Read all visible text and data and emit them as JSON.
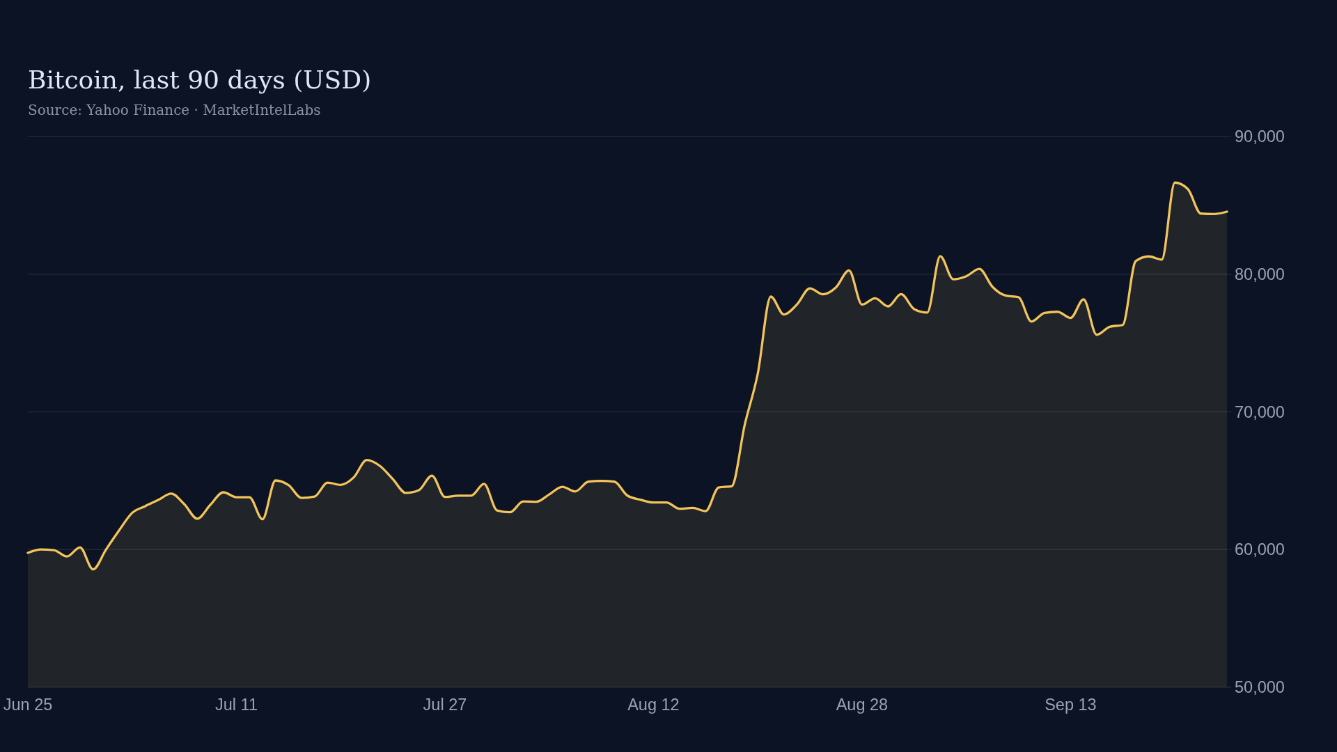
{
  "chart": {
    "source": "Source: Yahoo Finance · MarketIntelLabs",
    "chart_data": {
      "type": "area",
      "title": "Bitcoin, last 90 days (USD)",
      "grid": true,
      "categories": [
        "Jun 25",
        null,
        null,
        null,
        null,
        null,
        null,
        null,
        null,
        null,
        null,
        null,
        null,
        null,
        null,
        null,
        "Jul 11",
        null,
        null,
        null,
        null,
        null,
        null,
        null,
        null,
        null,
        null,
        null,
        null,
        null,
        null,
        null,
        "Jul 27",
        null,
        null,
        null,
        null,
        null,
        null,
        null,
        null,
        null,
        null,
        null,
        null,
        null,
        null,
        null,
        "Aug 12",
        null,
        null,
        null,
        null,
        null,
        null,
        null,
        null,
        null,
        null,
        null,
        null,
        null,
        null,
        null,
        "Aug 28",
        null,
        null,
        null,
        null,
        null,
        null,
        null,
        null,
        null,
        null,
        null,
        null,
        null,
        null,
        null,
        "Sep 13",
        null,
        null,
        null,
        null,
        null,
        null,
        null,
        null,
        null,
        null,
        null,
        null
      ],
      "values": [
        59760,
        60010,
        59960,
        59500,
        60160,
        58560,
        60010,
        61390,
        62660,
        63150,
        63600,
        64060,
        63300,
        62240,
        63250,
        64160,
        63800,
        63800,
        62200,
        65020,
        64680,
        63750,
        63850,
        64860,
        64700,
        65240,
        66500,
        66080,
        65120,
        64110,
        64310,
        65370,
        63820,
        63910,
        63910,
        64770,
        62840,
        62710,
        63500,
        63470,
        64000,
        64560,
        64220,
        64930,
        64990,
        64930,
        63920,
        63620,
        63420,
        63420,
        62960,
        63030,
        62790,
        64510,
        64600,
        69060,
        72770,
        78370,
        77070,
        77790,
        78970,
        78540,
        79040,
        80270,
        77790,
        78250,
        77660,
        78550,
        77460,
        77210,
        81310,
        79630,
        79850,
        80390,
        79090,
        78450,
        78330,
        76560,
        77190,
        77270,
        76820,
        78170,
        75600,
        76180,
        76310,
        80950,
        81290,
        81060,
        86650,
        86180,
        84400,
        84370,
        84540
      ],
      "ylim": [
        50000,
        90000
      ],
      "yticks": [
        {
          "value": 50000,
          "label": "50,000"
        },
        {
          "value": 60000,
          "label": "60,000"
        },
        {
          "value": 70000,
          "label": "70,000"
        },
        {
          "value": 80000,
          "label": "80,000"
        },
        {
          "value": 90000,
          "label": "90,000"
        }
      ]
    }
  }
}
